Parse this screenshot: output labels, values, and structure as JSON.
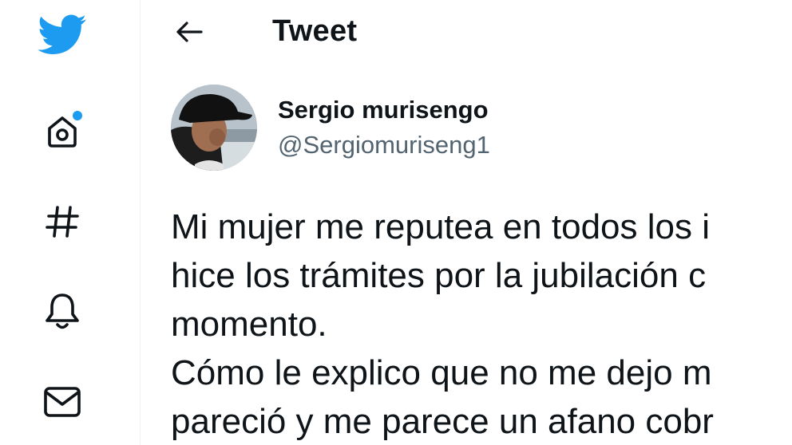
{
  "sidebar": {
    "items": [
      {
        "name": "twitter-logo",
        "icon": "twitter-bird-icon"
      },
      {
        "name": "home",
        "icon": "home-icon",
        "has_notification_dot": true
      },
      {
        "name": "explore",
        "icon": "hashtag-icon"
      },
      {
        "name": "notifications",
        "icon": "bell-icon"
      },
      {
        "name": "messages",
        "icon": "envelope-icon"
      }
    ]
  },
  "header": {
    "back_icon": "arrow-left-icon",
    "title": "Tweet"
  },
  "tweet": {
    "author": {
      "name": "Sergio murisengo",
      "handle": "@Sergiomuriseng1"
    },
    "text_lines": [
      "Mi mujer me reputea en todos los i",
      "hice los trámites por la jubilación c",
      "momento.",
      "Cómo le explico que no me dejo m",
      "pareció y me parece un afano cobr"
    ]
  },
  "colors": {
    "brand_blue": "#1d9bf0",
    "text_primary": "#0f1419",
    "text_secondary": "#536471",
    "border": "#eff3f4"
  }
}
